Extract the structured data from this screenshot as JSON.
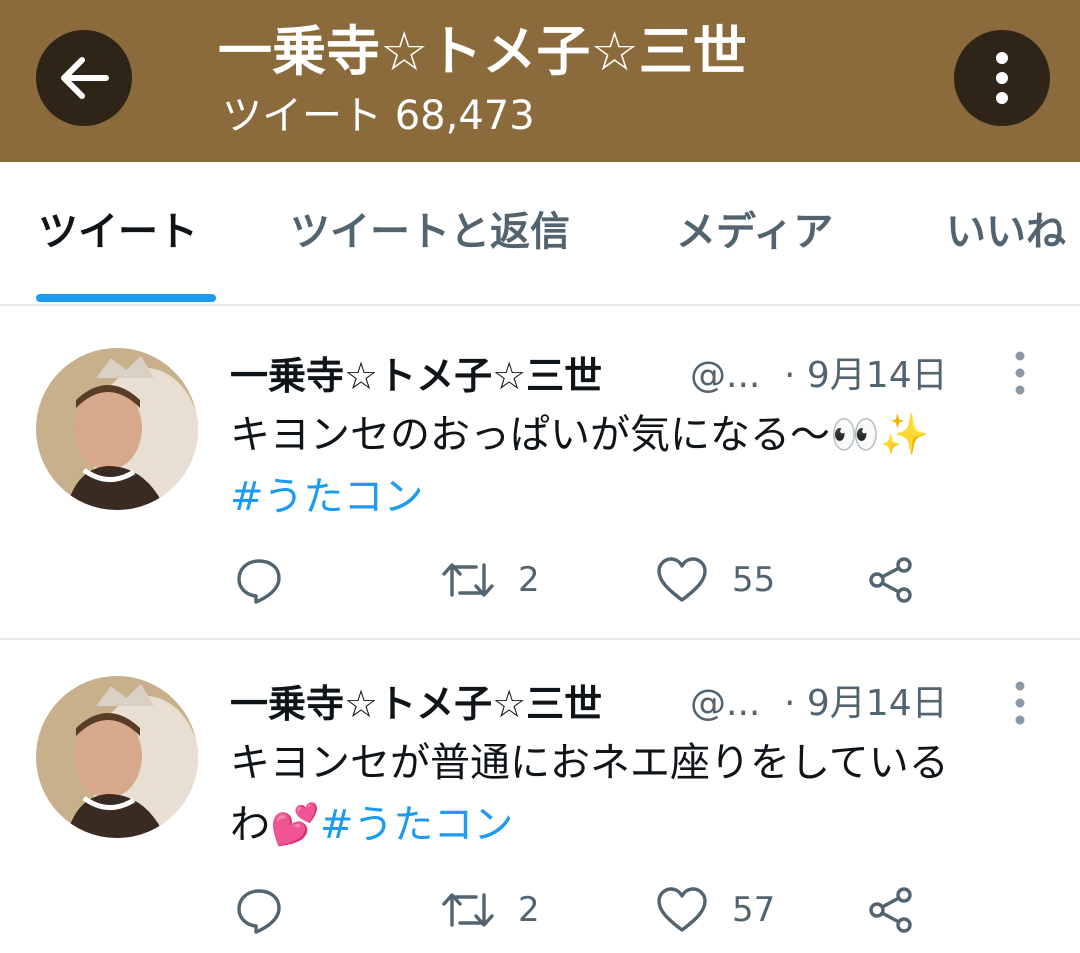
{
  "header": {
    "title": "一乗寺☆トメ子☆三世",
    "tweet_count": "ツイート 68,473"
  },
  "tabs": [
    {
      "label": "ツイート"
    },
    {
      "label": "ツイートと返信"
    },
    {
      "label": "メディア"
    },
    {
      "label": "いいね"
    }
  ],
  "tweets": [
    {
      "name": "一乗寺☆トメ子☆三世",
      "handle": "@...",
      "date": "· 9月14日",
      "text_line1": "キヨンセのおっぱいが気になる〜",
      "emoji1": "👀",
      "emoji2": "✨",
      "hashtag": "#うたコン",
      "retweets": "2",
      "likes": "55"
    },
    {
      "name": "一乗寺☆トメ子☆三世",
      "handle": "@...",
      "date": "· 9月14日",
      "text_line1": "キヨンセが普通におネエ座りをしている",
      "text_line2": "わ",
      "emoji1": "💕",
      "hashtag": "#うたコン",
      "retweets": "2",
      "likes": "57"
    }
  ],
  "colors": {
    "header_bg": "#8b6a3c",
    "accent": "#1d9bf0"
  }
}
